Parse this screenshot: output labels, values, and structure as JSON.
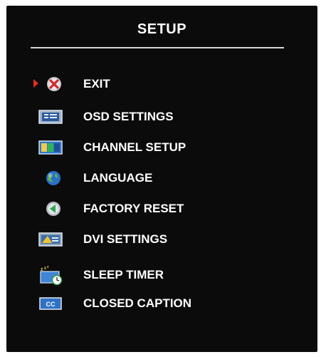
{
  "menu": {
    "title": "SETUP",
    "items": [
      {
        "label": "EXIT",
        "icon": "exit-icon",
        "selected": true
      },
      {
        "label": "OSD SETTINGS",
        "icon": "osd-settings-icon"
      },
      {
        "label": "CHANNEL SETUP",
        "icon": "channel-setup-icon"
      },
      {
        "label": "LANGUAGE",
        "icon": "language-globe-icon"
      },
      {
        "label": "FACTORY RESET",
        "icon": "factory-reset-icon"
      },
      {
        "label": "DVI SETTINGS",
        "icon": "dvi-settings-icon"
      },
      {
        "label": "SLEEP TIMER",
        "icon": "sleep-timer-icon"
      },
      {
        "label": "CLOSED CAPTION",
        "icon": "closed-caption-icon"
      }
    ]
  },
  "icons": {
    "closed_caption_text": "CC"
  },
  "colors": {
    "background": "#0b0b0b",
    "text": "#ffffff",
    "selection_pointer": "#e03020"
  }
}
